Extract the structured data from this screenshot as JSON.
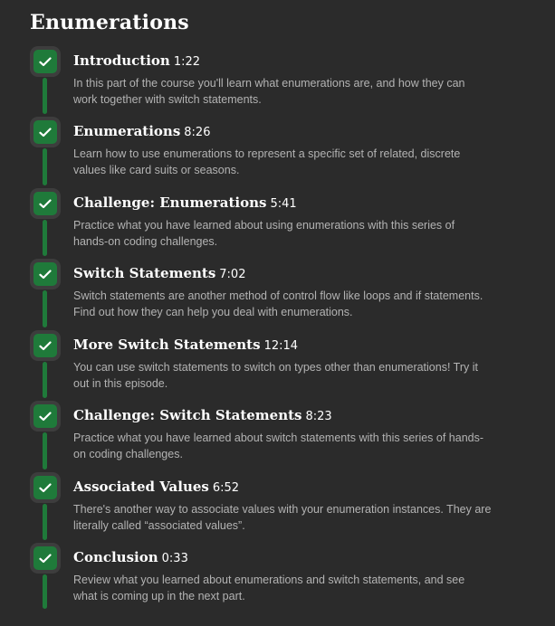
{
  "section": {
    "title": "Enumerations"
  },
  "episodes": [
    {
      "title": "Introduction",
      "duration": "1:22",
      "description": "In this part of the course you'll learn what enumerations are, and how they can work together with switch statements.",
      "completed": true
    },
    {
      "title": "Enumerations",
      "duration": "8:26",
      "description": "Learn how to use enumerations to represent a specific set of related, discrete values like card suits or seasons.",
      "completed": true
    },
    {
      "title": "Challenge: Enumerations",
      "duration": "5:41",
      "description": "Practice what you have learned about using enumerations with this series of hands-on coding challenges.",
      "completed": true
    },
    {
      "title": "Switch Statements",
      "duration": "7:02",
      "description": "Switch statements are another method of control flow like loops and if statements. Find out how they can help you deal with enumerations.",
      "completed": true
    },
    {
      "title": "More Switch Statements",
      "duration": "12:14",
      "description": "You can use switch statements to switch on types other than enumerations! Try it out in this episode.",
      "completed": true
    },
    {
      "title": "Challenge: Switch Statements",
      "duration": "8:23",
      "description": "Practice what you have learned about switch statements with this series of hands-on coding challenges.",
      "completed": true
    },
    {
      "title": "Associated Values",
      "duration": "6:52",
      "description": "There's another way to associate values with your enumeration instances. They are literally called “associated values”.",
      "completed": true
    },
    {
      "title": "Conclusion",
      "duration": "0:33",
      "description": "Review what you learned about enumerations and switch statements, and see what is coming up in the next part.",
      "completed": true
    }
  ],
  "icons": {
    "check": "checkmark-icon"
  },
  "colors": {
    "background": "#2b2b2b",
    "check_fill": "#1f7a3a",
    "check_frame": "#3d3d3d",
    "connector": "#1f7a3a",
    "title_text": "#ffffff",
    "description_text": "#b3b3b3"
  }
}
